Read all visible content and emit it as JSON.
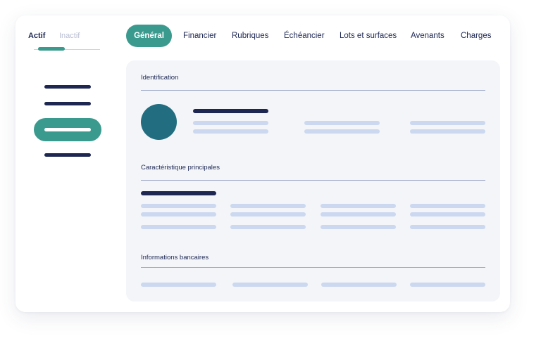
{
  "status": {
    "active_label": "Actif",
    "inactive_label": "Inactif"
  },
  "tabs": {
    "active": "Général",
    "items": [
      "Financier",
      "Rubriques",
      "Échéancier",
      "Lots et surfaces",
      "Avenants",
      "Charges"
    ]
  },
  "sections": {
    "identification": "Identification",
    "main_features": "Caractéristique principales",
    "bank_info": "Informations bancaires"
  },
  "colors": {
    "accent": "#3a9a8e",
    "navy": "#1d2752",
    "avatar": "#226d7f",
    "placeholder": "#cbd8ef",
    "panel_bg": "#f3f5f9"
  }
}
